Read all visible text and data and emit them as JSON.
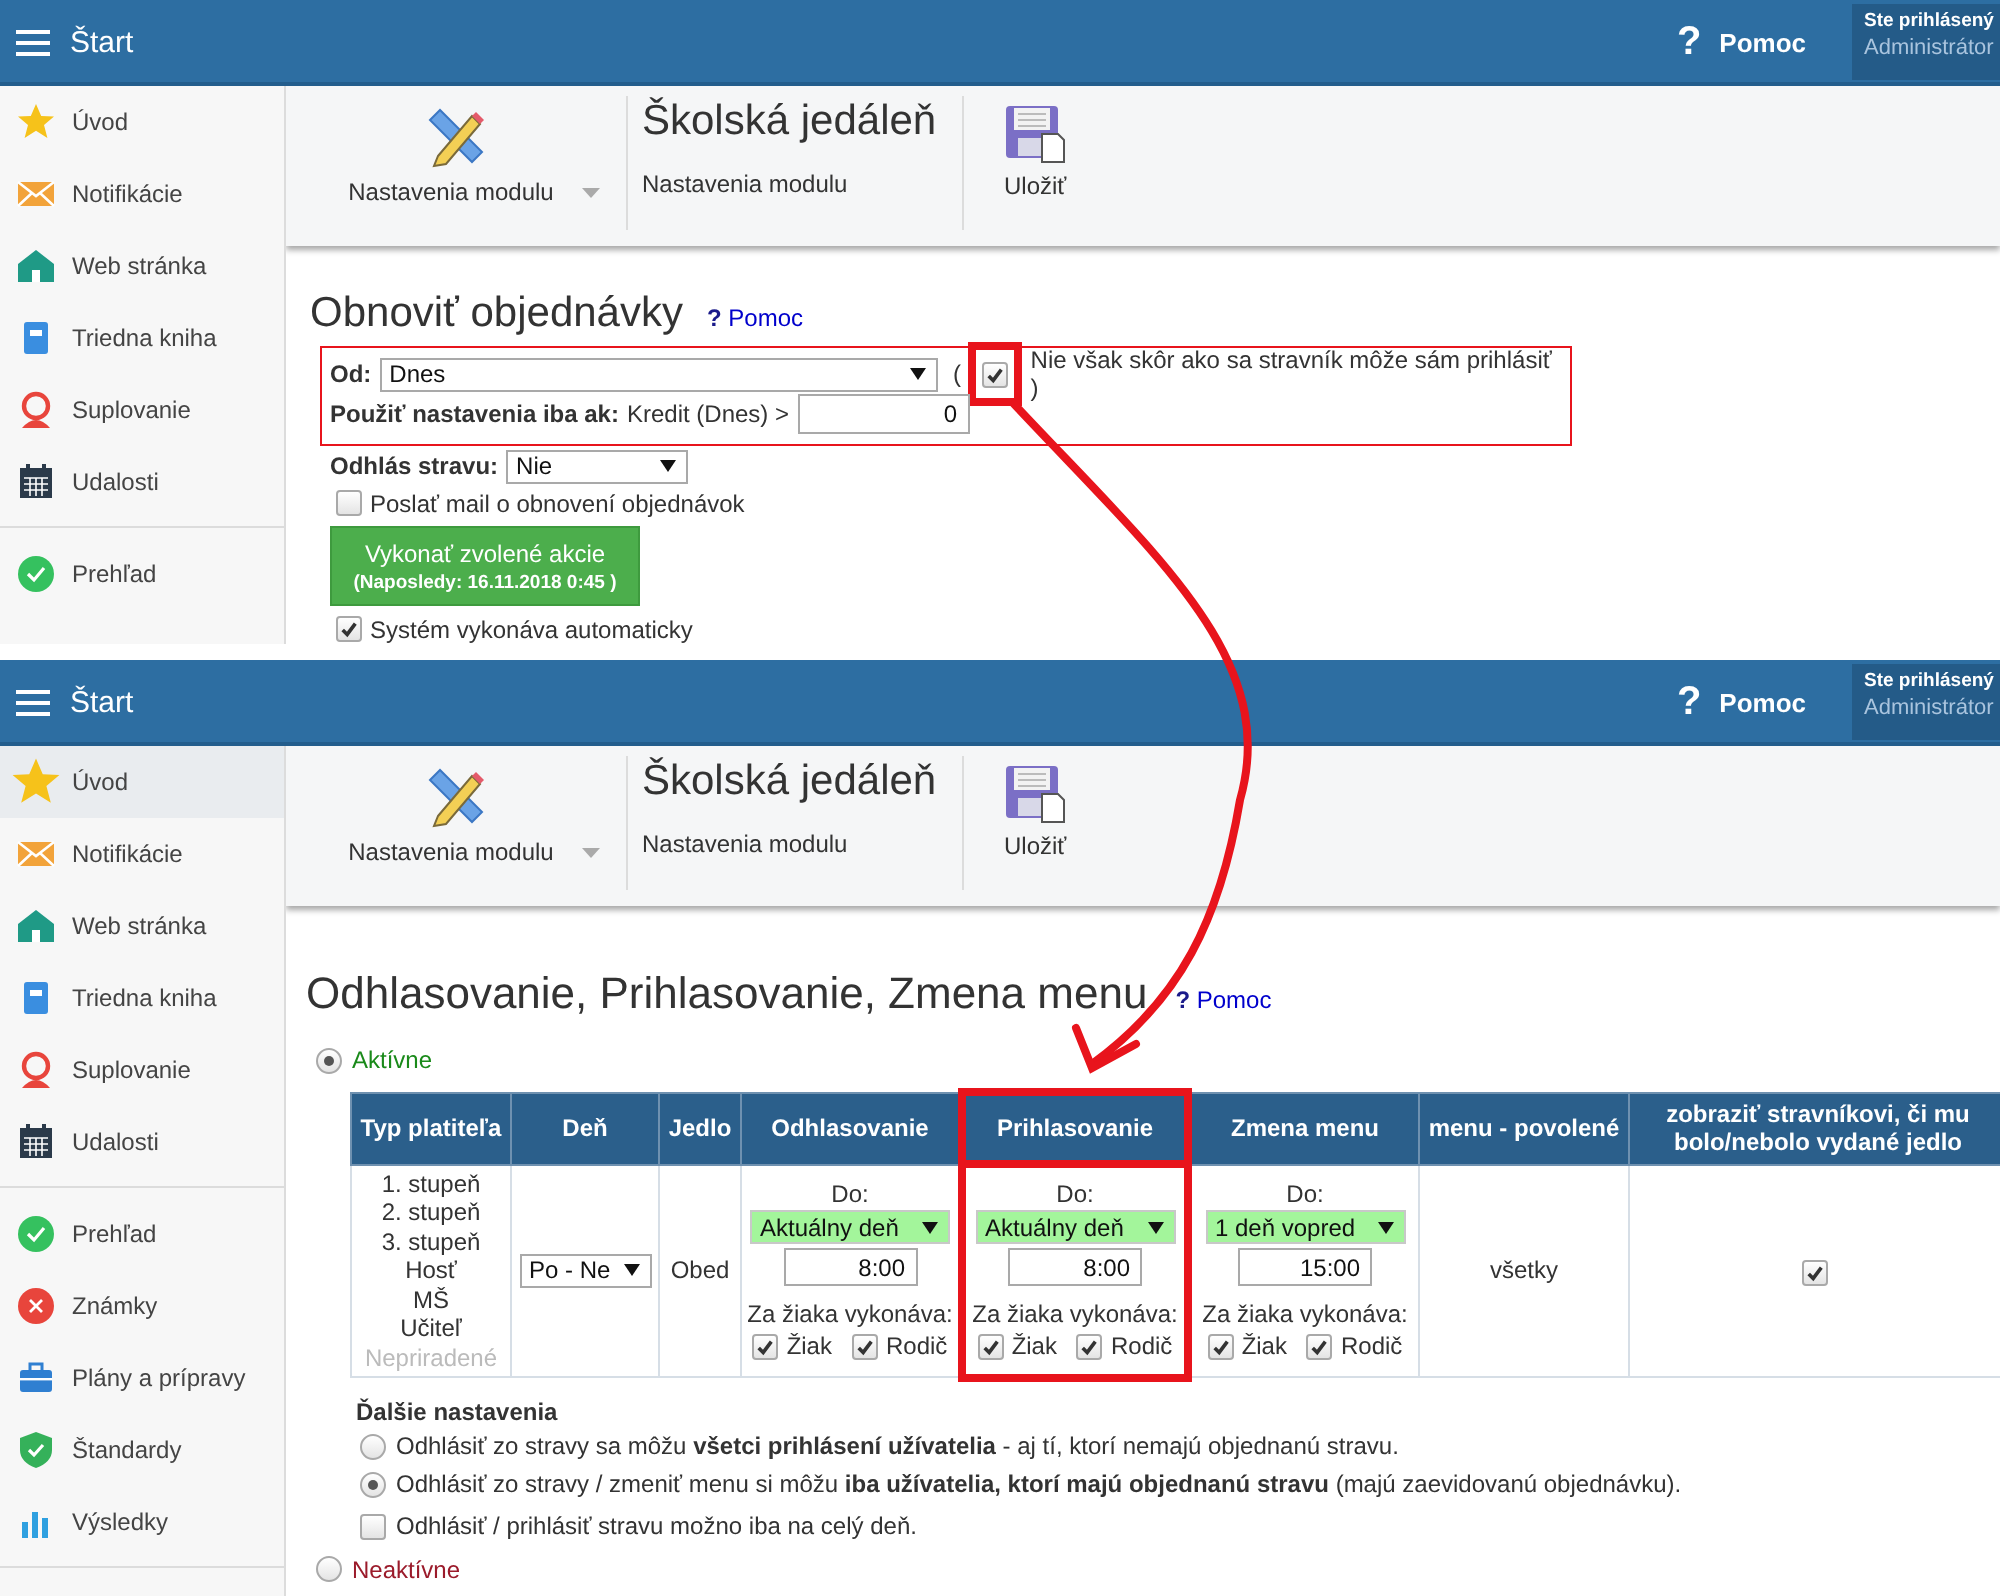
{
  "screens": [
    {
      "header": {
        "title": "Štart",
        "help": {
          "icon": "?",
          "label": "Pomoc"
        },
        "user_label": "Ste prihlásený",
        "user_name": "Administrátor"
      },
      "sidebar": [
        {
          "label": "Úvod",
          "selected": false
        },
        {
          "label": "Notifikácie",
          "selected": false
        },
        {
          "label": "Web stránka",
          "selected": false
        },
        {
          "label": "Triedna kniha",
          "selected": false
        },
        {
          "label": "Suplovanie",
          "selected": false
        },
        {
          "label": "Udalosti",
          "selected": false
        },
        {
          "label": "Prehľad",
          "selected": false
        }
      ],
      "toolbar": {
        "module_button": "Nastavenia modulu",
        "title": "Školská jedáleň",
        "subtitle": "Nastavenia modulu",
        "save_button": "Uložiť"
      },
      "content": {
        "kind": "restore_orders",
        "heading": "Obnoviť objednávky",
        "help_link": "**?** Pomoc",
        "settings_box": {
          "highlighted": true,
          "from_label": "Od:",
          "from_value": "Dnes",
          "paren": "(",
          "limit_checkbox": {
            "label": "Nie však skôr ako sa stravník môže sám prihlásiť )",
            "checked": true,
            "highlighted": true
          },
          "condition_label": "Použiť nastavenia iba ak:",
          "condition_text": "Kredit (Dnes) >",
          "condition_value": "0"
        },
        "unsubscribe": {
          "label": "Odhlás stravu:",
          "value": "Nie"
        },
        "mail_checkbox": {
          "label": "Poslať mail o obnovení objednávok",
          "checked": false
        },
        "run_button": {
          "label": "Vykonať zvolené akcie",
          "note": "(Naposledy: 16.11.2018 0:45 )"
        },
        "auto_checkbox": {
          "label": "Systém vykonáva automaticky",
          "checked": true
        }
      }
    },
    {
      "header": {
        "title": "Štart",
        "help": {
          "icon": "?",
          "label": "Pomoc"
        },
        "user_label": "Ste prihlásený",
        "user_name": "Administrátor"
      },
      "sidebar": [
        {
          "label": "Úvod",
          "selected": true
        },
        {
          "label": "Notifikácie",
          "selected": false
        },
        {
          "label": "Web stránka",
          "selected": false
        },
        {
          "label": "Triedna kniha",
          "selected": false
        },
        {
          "label": "Suplovanie",
          "selected": false
        },
        {
          "label": "Udalosti",
          "selected": false
        },
        {
          "label": "Prehľad",
          "selected": false
        },
        {
          "label": "Známky",
          "selected": false
        },
        {
          "label": "Plány a prípravy",
          "selected": false
        },
        {
          "label": "Štandardy",
          "selected": false
        },
        {
          "label": "Výsledky",
          "selected": false
        }
      ],
      "toolbar": {
        "module_button": "Nastavenia modulu",
        "title": "Školská jedáleň",
        "subtitle": "Nastavenia modulu",
        "save_button": "Uložiť"
      },
      "content": {
        "kind": "meal_rules",
        "heading": "Odhlasovanie, Prihlasovanie, Zmena menu",
        "help_link": "**?** Pomoc",
        "active_radio": {
          "label": "Aktívne",
          "selected": true
        },
        "table": {
          "columns": [
            {
              "label": "Typ platiteľa",
              "highlighted": false
            },
            {
              "label": "Deň",
              "highlighted": false
            },
            {
              "label": "Jedlo",
              "highlighted": false
            },
            {
              "label": "Odhlasovanie",
              "highlighted": false
            },
            {
              "label": "Prihlasovanie",
              "highlighted": true
            },
            {
              "label": "Zmena menu",
              "highlighted": false
            },
            {
              "label": "menu - povolené",
              "highlighted": false
            },
            {
              "label": "zobraziť stravníkovi, či mu bolo/nebolo vydané jedlo",
              "highlighted": false
            }
          ],
          "row": {
            "payer_types": [
              {
                "label": "1. stupeň",
                "disabled": false
              },
              {
                "label": "2. stupeň",
                "disabled": false
              },
              {
                "label": "3. stupeň",
                "disabled": false
              },
              {
                "label": "Hosť",
                "disabled": false
              },
              {
                "label": "MŠ",
                "disabled": false
              },
              {
                "label": "Učiteľ",
                "disabled": false
              },
              {
                "label": "Nepriradené",
                "disabled": true
              }
            ],
            "day": "Po - Ne",
            "meal": "Obed",
            "deadlines": [
              {
                "label": "Do:",
                "when": "Aktuálny deň",
                "time": "8:00",
                "performer_label": "Za žiaka vykonáva:",
                "performers": [
                  {
                    "label": "Žiak",
                    "checked": true
                  },
                  {
                    "label": "Rodič",
                    "checked": true
                  }
                ]
              },
              {
                "label": "Do:",
                "when": "Aktuálny deň",
                "time": "8:00",
                "performer_label": "Za žiaka vykonáva:",
                "performers": [
                  {
                    "label": "Žiak",
                    "checked": true
                  },
                  {
                    "label": "Rodič",
                    "checked": true
                  }
                ]
              },
              {
                "label": "Do:",
                "when": "1 deň vopred",
                "time": "15:00",
                "performer_label": "Za žiaka vykonáva:",
                "performers": [
                  {
                    "label": "Žiak",
                    "checked": true
                  },
                  {
                    "label": "Rodič",
                    "checked": true
                  }
                ]
              }
            ],
            "menu": "všetky",
            "show_served": {
              "checked": true
            }
          }
        },
        "more_settings": {
          "title": "Ďalšie nastavenia",
          "options": [
            {
              "kind": "radio",
              "label": "Odhlásiť zo stravy sa môžu **všetci prihlásení užívatelia** - aj tí, ktorí nemajú objednanú stravu.",
              "selected": false
            },
            {
              "kind": "radio",
              "label": "Odhlásiť zo stravy / zmeniť menu si môžu **iba užívatelia, ktorí majú objednanú stravu** (majú zaevidovanú objednávku).",
              "selected": true
            },
            {
              "kind": "checkbox",
              "label": "Odhlásiť / prihlásiť stravu možno iba na celý deň.",
              "checked": false
            }
          ]
        },
        "inactive_radio": {
          "label": "Neaktívne",
          "selected": false
        }
      }
    }
  ]
}
